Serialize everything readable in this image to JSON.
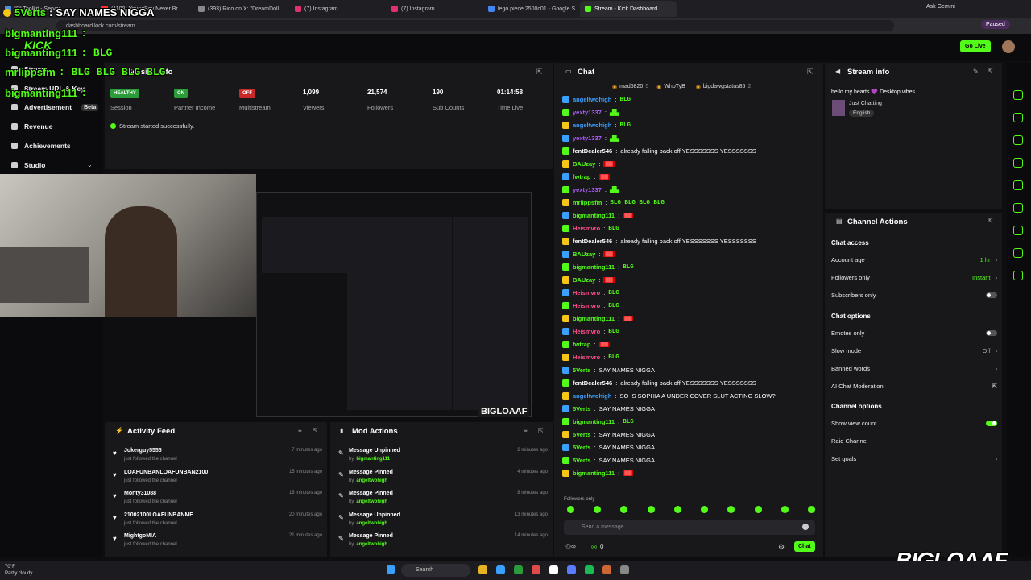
{
  "browser": {
    "tabs": [
      {
        "label": "IRLToolkit - Server",
        "color": "#4a90e2"
      },
      {
        "label": "(1109) YoungBoy Never Br...",
        "color": "#ff3333"
      },
      {
        "label": "(393) Rico on X: \"DreamDoll...",
        "color": "#888888"
      },
      {
        "label": "(7) Instagram",
        "color": "#e1306c"
      },
      {
        "label": "(7) Instagram",
        "color": "#e1306c"
      },
      {
        "label": "lego piece 2500c01 - Google S...",
        "color": "#4285f4"
      },
      {
        "label": "Stream - Kick Dashboard",
        "color": "#53fc18"
      }
    ],
    "url": "dashboard.kick.com/stream",
    "ask_gemini": "Ask Gemini",
    "paused": "Paused"
  },
  "overlay": {
    "alert_name": "5Verts",
    "alert_text": "SAY NAMES NIGGA",
    "chat_lines": [
      {
        "user": "bigmanting111",
        "text": ":"
      },
      {
        "user": "bigmanting111",
        "text": ": BLG"
      },
      {
        "user": "mrlippsfm",
        "text": ": BLG BLG BLG BLG"
      },
      {
        "user": "bigmanting111",
        "text": ":"
      }
    ],
    "watermark": "BIGLOAAF"
  },
  "sidebar": {
    "items": [
      {
        "label": "Stream",
        "icon": "stream-icon"
      },
      {
        "label": "Stream URL & Key",
        "icon": "key-icon"
      },
      {
        "label": "Advertisement",
        "icon": "ad-icon",
        "badge": "Beta"
      },
      {
        "label": "Revenue",
        "icon": "money-icon"
      },
      {
        "label": "Achievements",
        "icon": "trophy-icon"
      },
      {
        "label": "Studio",
        "icon": "studio-icon"
      }
    ]
  },
  "session": {
    "title": "Session Info",
    "stats": [
      {
        "badge": "HEALTHY",
        "label": "Session",
        "badge_color": "#2a9d3a"
      },
      {
        "badge": "ON",
        "label": "Partner Income",
        "badge_color": "#2a9d3a"
      },
      {
        "badge": "OFF",
        "label": "Multistream",
        "badge_color": "#c92828"
      },
      {
        "value": "1,099",
        "label": "Viewers"
      },
      {
        "value": "21,574",
        "label": "Followers"
      },
      {
        "value": "190",
        "label": "Sub Counts"
      },
      {
        "value": "01:14:58",
        "label": "Time Live"
      }
    ],
    "status": "Stream started successfully."
  },
  "chat": {
    "title": "Chat",
    "pinned": [
      "mad5820",
      "WhoTyB",
      "bigdawgstatus85"
    ],
    "pinned_counts": [
      "5",
      "",
      "2"
    ],
    "messages": [
      {
        "user": "angeltwohigh",
        "color": "#3aa0ff",
        "text": "BLG",
        "blg": true
      },
      {
        "user": "yexty1337",
        "color": "#b05cff",
        "text": ""
      },
      {
        "user": "angeltwohigh",
        "color": "#3aa0ff",
        "text": "BLG",
        "blg": true
      },
      {
        "user": "yexty1337",
        "color": "#b05cff",
        "text": ""
      },
      {
        "user": "fentDealer546",
        "color": "#ffffff",
        "text": "already falling back off YESSSSSSS YESSSSSSS"
      },
      {
        "user": "BAUzay",
        "color": "#53fc18",
        "text": "",
        "red": true
      },
      {
        "user": "fwtrap",
        "color": "#53fc18",
        "text": "",
        "red": true
      },
      {
        "user": "yexty1337",
        "color": "#b05cff",
        "text": ""
      },
      {
        "user": "mrlippsfm",
        "color": "#53fc18",
        "text": "BLG BLG BLG BLG",
        "blg": true
      },
      {
        "user": "bigmanting111",
        "color": "#53fc18",
        "text": "",
        "red": true
      },
      {
        "user": "Heismvro",
        "color": "#ff4d8d",
        "text": "BLG",
        "blg": true
      },
      {
        "user": "fentDealer546",
        "color": "#ffffff",
        "text": "already falling back off YESSSSSSS YESSSSSSS"
      },
      {
        "user": "BAUzay",
        "color": "#53fc18",
        "text": "",
        "red": true
      },
      {
        "user": "bigmanting111",
        "color": "#53fc18",
        "text": "BLG",
        "blg": true
      },
      {
        "user": "BAUzay",
        "color": "#53fc18",
        "text": "",
        "red": true
      },
      {
        "user": "Heismvro",
        "color": "#ff4d8d",
        "text": "BLG",
        "blg": true
      },
      {
        "user": "Heismvro",
        "color": "#ff4d8d",
        "text": "BLG",
        "blg": true
      },
      {
        "user": "bigmanting111",
        "color": "#53fc18",
        "text": "",
        "red": true
      },
      {
        "user": "Heismvro",
        "color": "#ff4d8d",
        "text": "BLG",
        "blg": true
      },
      {
        "user": "fwtrap",
        "color": "#53fc18",
        "text": "",
        "red": true
      },
      {
        "user": "Heismvro",
        "color": "#ff4d8d",
        "text": "BLG",
        "blg": true
      },
      {
        "user": "5Verts",
        "color": "#53fc18",
        "text": "SAY NAMES NIGGA"
      },
      {
        "user": "fentDealer546",
        "color": "#ffffff",
        "text": "already falling back off YESSSSSSS YESSSSSSS"
      },
      {
        "user": "angeltwohigh",
        "color": "#3aa0ff",
        "text": "SO IS SOPHIA A UNDER COVER SLUT ACTING SLOW?"
      },
      {
        "user": "5Verts",
        "color": "#53fc18",
        "text": "SAY NAMES NIGGA"
      },
      {
        "user": "bigmanting111",
        "color": "#53fc18",
        "text": "BLG",
        "blg": true
      },
      {
        "user": "5Verts",
        "color": "#53fc18",
        "text": "SAY NAMES NIGGA"
      },
      {
        "user": "5Verts",
        "color": "#53fc18",
        "text": "SAY NAMES NIGGA"
      },
      {
        "user": "5Verts",
        "color": "#53fc18",
        "text": "SAY NAMES NIGGA"
      },
      {
        "user": "bigmanting111",
        "color": "#53fc18",
        "text": "",
        "red": true
      }
    ],
    "followers_only": "Followers only",
    "input_placeholder": "Send a message",
    "count": "0",
    "send": "Chat"
  },
  "stream_info": {
    "title": "Stream info",
    "stream_title": "hello my hearts 💜 Desktop vibes",
    "category": "Just Chatting",
    "language": "English"
  },
  "channel_actions": {
    "title": "Channel Actions",
    "chat_access": "Chat access",
    "rows1": [
      {
        "label": "Account age",
        "value": "1 hr",
        "type": "arrow"
      },
      {
        "label": "Followers only",
        "value": "Instant",
        "type": "arrow"
      },
      {
        "label": "Subscribers only",
        "value": "",
        "type": "off"
      }
    ],
    "chat_options": "Chat options",
    "rows2": [
      {
        "label": "Emotes only",
        "value": "",
        "type": "off"
      },
      {
        "label": "Slow mode",
        "value": "Off",
        "type": "arrow"
      },
      {
        "label": "Banned words",
        "value": "",
        "type": "arrow"
      },
      {
        "label": "AI Chat Moderation",
        "value": "",
        "type": "ext"
      }
    ],
    "channel_options": "Channel options",
    "rows3": [
      {
        "label": "Show view count",
        "value": "",
        "type": "on"
      },
      {
        "label": "Raid Channel",
        "value": "",
        "type": "none"
      },
      {
        "label": "Set goals",
        "value": "",
        "type": "arrow"
      }
    ]
  },
  "activity": {
    "title": "Activity Feed",
    "items": [
      {
        "name": "Jokerguy5555",
        "sub": "just followed the channel",
        "time": "7 minutes ago"
      },
      {
        "name": "LOAFUNBANLOAFUNBAN2100",
        "sub": "just followed the channel",
        "time": "15 minutes ago"
      },
      {
        "name": "Monty31088",
        "sub": "just followed the channel",
        "time": "18 minutes ago"
      },
      {
        "name": "21002100LOAFUNBANME",
        "sub": "just followed the channel",
        "time": "20 minutes ago"
      },
      {
        "name": "MightgoMIA",
        "sub": "just followed the channel",
        "time": "21 minutes ago"
      }
    ]
  },
  "mod": {
    "title": "Mod Actions",
    "items": [
      {
        "name": "Message Unpinned",
        "by": "by",
        "user": "bigmanting111",
        "time": "2 minutes ago"
      },
      {
        "name": "Message Pinned",
        "by": "by",
        "user": "angeltwohigh",
        "time": "4 minutes ago"
      },
      {
        "name": "Message Pinned",
        "by": "by",
        "user": "angeltwohigh",
        "time": "8 minutes ago"
      },
      {
        "name": "Message Unpinned",
        "by": "by",
        "user": "angeltwohigh",
        "time": "13 minutes ago"
      },
      {
        "name": "Message Pinned",
        "by": "by",
        "user": "angeltwohigh",
        "time": "14 minutes ago"
      }
    ]
  },
  "weather": {
    "temp": "70°F",
    "desc": "Partly cloudy"
  },
  "taskbar": {
    "search": "Search"
  },
  "go_live": "Go Live",
  "colors": {
    "accent": "#53fc18",
    "bg": "#0e0e10",
    "panel": "#18181b"
  }
}
